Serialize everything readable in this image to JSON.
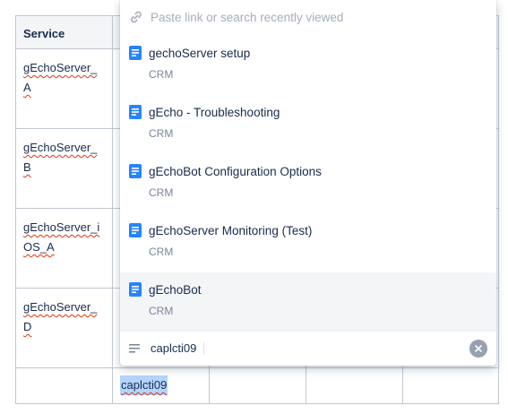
{
  "table": {
    "header": [
      "Service",
      "",
      "",
      "",
      ""
    ],
    "rows": [
      {
        "service": "gEchoServer_A",
        "cell2": ""
      },
      {
        "service": "gEchoServer_B",
        "cell2": ""
      },
      {
        "service": "gEchoServer_iOS_A",
        "cell2": ""
      },
      {
        "service": "gEchoServer_D",
        "cell2": ""
      },
      {
        "service": "",
        "cell2": "caplcti09"
      }
    ]
  },
  "popup": {
    "search_placeholder": "Paste link or search recently viewed",
    "results": [
      {
        "title": "gechoServer setup",
        "space": "CRM"
      },
      {
        "title": "gEcho - Troubleshooting",
        "space": "CRM"
      },
      {
        "title": "gEchoBot Configuration Options",
        "space": "CRM"
      },
      {
        "title": "gEchoServer Monitoring (Test)",
        "space": "CRM"
      },
      {
        "title": "gEchoBot",
        "space": "CRM"
      }
    ],
    "footer_text": "caplcti09"
  },
  "icons": {
    "link": "link-icon",
    "page": "page-icon",
    "text": "text-lines-icon",
    "clear": "clear-icon"
  },
  "colors": {
    "page_icon": "#2684ff",
    "selection": "#b3d4ff",
    "active_row": "#f4f5f7",
    "spellcheck": "#de350b"
  }
}
